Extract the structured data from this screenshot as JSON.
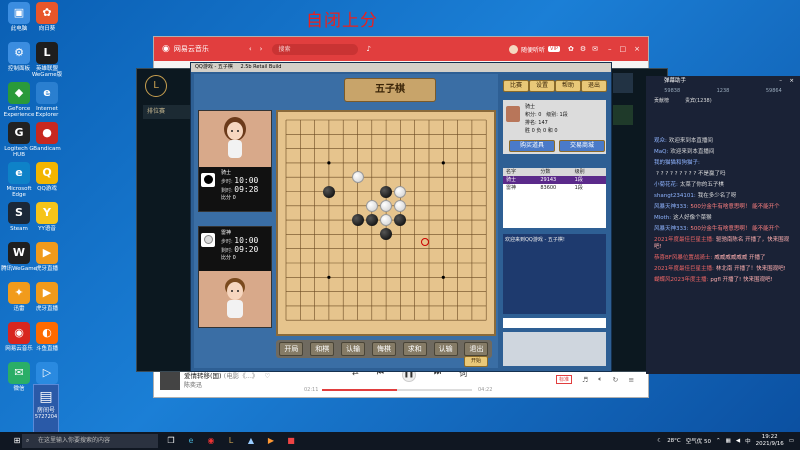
{
  "stream_title": "自闭上分",
  "desktop_icons_left": [
    {
      "label": "此电脑",
      "color": "#3b8de0",
      "glyph": "▣"
    },
    {
      "label": "控制面板",
      "color": "#3b8de0",
      "glyph": "⚙"
    },
    {
      "label": "GeForce Experience",
      "color": "#2a9a3a",
      "glyph": "◆"
    },
    {
      "label": "Logitech G HUB",
      "color": "#222",
      "glyph": "G"
    },
    {
      "label": "Microsoft Edge",
      "color": "#0e82c8",
      "glyph": "e"
    },
    {
      "label": "Steam",
      "color": "#1b2838",
      "glyph": "S"
    },
    {
      "label": "腾讯WeGame",
      "color": "#1f1f1f",
      "glyph": "W"
    },
    {
      "label": "迅雷",
      "color": "#f19b1c",
      "glyph": "✦"
    },
    {
      "label": "网易云音乐",
      "color": "#d8261f",
      "glyph": "◉"
    },
    {
      "label": "微信",
      "color": "#2aae67",
      "glyph": "✉"
    }
  ],
  "desktop_icons_right": [
    {
      "label": "向日葵",
      "color": "#e8562a",
      "glyph": "✿"
    },
    {
      "label": "英雄联盟WeGame版",
      "color": "#1e1e1e",
      "glyph": "L"
    },
    {
      "label": "Internet Explorer",
      "color": "#2a7fd0",
      "glyph": "e"
    },
    {
      "label": "Bandicam",
      "color": "#c8281f",
      "glyph": "●"
    },
    {
      "label": "QQ游戏",
      "color": "#f3b500",
      "glyph": "Q"
    },
    {
      "label": "YY语音",
      "color": "#f6c419",
      "glyph": "Y"
    },
    {
      "label": "虎牙直播",
      "color": "#f09a1b",
      "glyph": "▶"
    },
    {
      "label": "虎牙直播",
      "color": "#f09a1b",
      "glyph": "▶"
    },
    {
      "label": "斗鱼直播",
      "color": "#ff6a00",
      "glyph": "◐"
    },
    {
      "label": "腾讯视频",
      "color": "#2a8ae0",
      "glyph": "▷"
    }
  ],
  "corner_overlay": {
    "label": "房间号",
    "number": "5727204"
  },
  "music": {
    "app_name": "网易云音乐",
    "search_placeholder": "搜索",
    "user_name": "随便听听",
    "vip_badge": "VIP",
    "song_title": "爱情转移(国)",
    "song_sub": "(电影《...》",
    "artist": "陈奕迅",
    "time_current": "02:11",
    "time_total": "04:22",
    "mode_badge": "标准",
    "progress": 0.5
  },
  "lol": {
    "menu_label": "排位赛"
  },
  "gomoku": {
    "window_title": "QQ游戏 - 五子棋",
    "version": "2.5b Retail Build",
    "banner": "五子棋",
    "players": [
      {
        "name": "骑士",
        "step_label": "步时:",
        "step_time": "10:00",
        "total_label": "剩时:",
        "total_time": "09:28",
        "score_label": "比分 0"
      },
      {
        "name": "雷神",
        "step_label": "步时:",
        "step_time": "10:00",
        "total_label": "剩时:",
        "total_time": "09:20",
        "score_label": "比分 0"
      }
    ],
    "action_buttons": [
      "开局",
      "和棋",
      "认输",
      "悔棋",
      "求和",
      "认输",
      "退出"
    ],
    "small_button": "开始",
    "top_buttons": [
      "比赛",
      "设置",
      "帮助",
      "退出"
    ],
    "info": {
      "name": "骑士",
      "score_label": "积分:",
      "score": "0",
      "level_label": "级别:",
      "level": "1段",
      "rank_label": "排名:",
      "rank": "147",
      "win_label": "胜",
      "win": "0",
      "lose_label": "负",
      "lose": "0",
      "draw_label": "和",
      "draw": "0"
    },
    "mid_buttons": [
      "购买道具",
      "交易商城"
    ],
    "list_headers": [
      "名字",
      "分数",
      "级别"
    ],
    "list_rows": [
      [
        "骑士",
        "29143",
        "1段"
      ],
      [
        "雷神",
        "83600",
        "1段"
      ]
    ],
    "chat_lines": [
      "欢迎来到QQ游戏 - 五子棋!"
    ],
    "stones": [
      {
        "c": 5,
        "r": 4,
        "color": "w"
      },
      {
        "c": 7,
        "r": 5,
        "color": "b"
      },
      {
        "c": 8,
        "r": 5,
        "color": "w"
      },
      {
        "c": 6,
        "r": 6,
        "color": "w"
      },
      {
        "c": 7,
        "r": 6,
        "color": "w"
      },
      {
        "c": 8,
        "r": 6,
        "color": "w"
      },
      {
        "c": 5,
        "r": 7,
        "color": "b"
      },
      {
        "c": 6,
        "r": 7,
        "color": "b"
      },
      {
        "c": 7,
        "r": 7,
        "color": "w"
      },
      {
        "c": 8,
        "r": 7,
        "color": "b"
      },
      {
        "c": 7,
        "r": 8,
        "color": "b"
      },
      {
        "c": 3,
        "r": 5,
        "color": "b"
      }
    ]
  },
  "chat": {
    "header_title": "弹幕助手",
    "stats": [
      "59838",
      "1238",
      "59864"
    ],
    "tabs": [
      "贡献榜",
      "贵宾(1238)"
    ],
    "messages": [
      {
        "user": "观众:",
        "text": "欢迎来到本直播间",
        "type": "normal"
      },
      {
        "user": "MaQ:",
        "text": "欢迎来到本直播间",
        "type": "normal"
      },
      {
        "user": "我的猫猫和狗猫子:",
        "text": "",
        "type": "normal"
      },
      {
        "user": "",
        "text": "? ? ? ? ? ? ? ? ? 不是赢了吗",
        "type": "normal"
      },
      {
        "user": "小菊花花:",
        "text": "太菜了你的五子棋",
        "type": "normal"
      },
      {
        "user": "shangt234101:",
        "text": "我在多少名了呀",
        "type": "normal"
      },
      {
        "user": "风暴天神333:",
        "text": "500分金牛有啥意思啊！ 能不能开个",
        "type": "hl"
      },
      {
        "user": "Mloth:",
        "text": "这人好像个菜猴",
        "type": "normal"
      },
      {
        "user": "风暴天神333:",
        "text": "500分金牛有啥意思啊！ 能不能开个",
        "type": "hl"
      },
      {
        "user": "2021年度最佳巨星主播:",
        "text": "驱驰南陈名 开播了，快来围观吧!",
        "type": "sys"
      },
      {
        "user": "恭喜BF风暴位置战骑士:",
        "text": "威威威威威威 开播了",
        "type": "sys"
      },
      {
        "user": "2021年度最佳巨星主播:",
        "text": "林北南 开播了！快来围观吧!",
        "type": "sys"
      },
      {
        "user": "蝴蝶风2023年度主播:",
        "text": "pgfl 开播了! 快来围观吧!",
        "type": "sys"
      }
    ]
  },
  "taskbar": {
    "search_placeholder": "在这里输入你要搜索的内容",
    "temperature": "28°C",
    "air_quality": "空气优 50",
    "time": "19:22",
    "date": "2021/9/16",
    "ime": "中"
  }
}
